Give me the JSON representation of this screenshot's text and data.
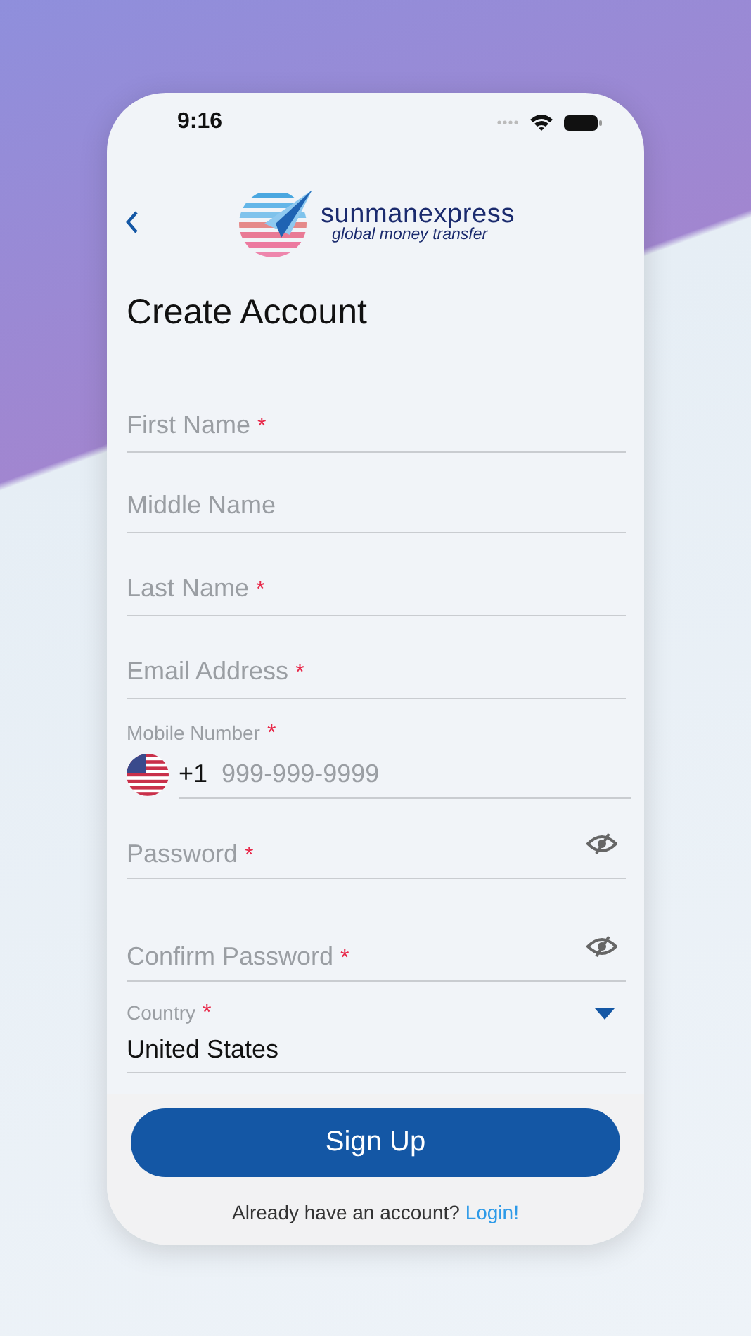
{
  "status_bar": {
    "time": "9:16"
  },
  "brand": {
    "name": "sunmanexpress",
    "tagline": "global money transfer"
  },
  "title": "Create Account",
  "fields": [
    {
      "kind": "text",
      "placeholder": "First Name",
      "required_mark": "*"
    },
    {
      "kind": "text",
      "placeholder": "Middle Name"
    },
    {
      "kind": "text",
      "placeholder": "Last Name",
      "required_mark": "*"
    },
    {
      "kind": "text",
      "placeholder": "Email Address",
      "required_mark": "*"
    },
    {
      "kind": "phone",
      "label": "Mobile Number",
      "required_mark": "*",
      "code": "+1",
      "placeholder": "999-999-9999"
    },
    {
      "kind": "password",
      "placeholder": "Password",
      "required_mark": "*"
    },
    {
      "kind": "password",
      "placeholder": "Confirm Password",
      "required_mark": "*"
    },
    {
      "kind": "select",
      "label": "Country",
      "required_mark": "*",
      "value": "United States"
    }
  ],
  "sign_up_button": "Sign Up",
  "footer": {
    "text": "Already have an account?",
    "link": "Login!"
  }
}
